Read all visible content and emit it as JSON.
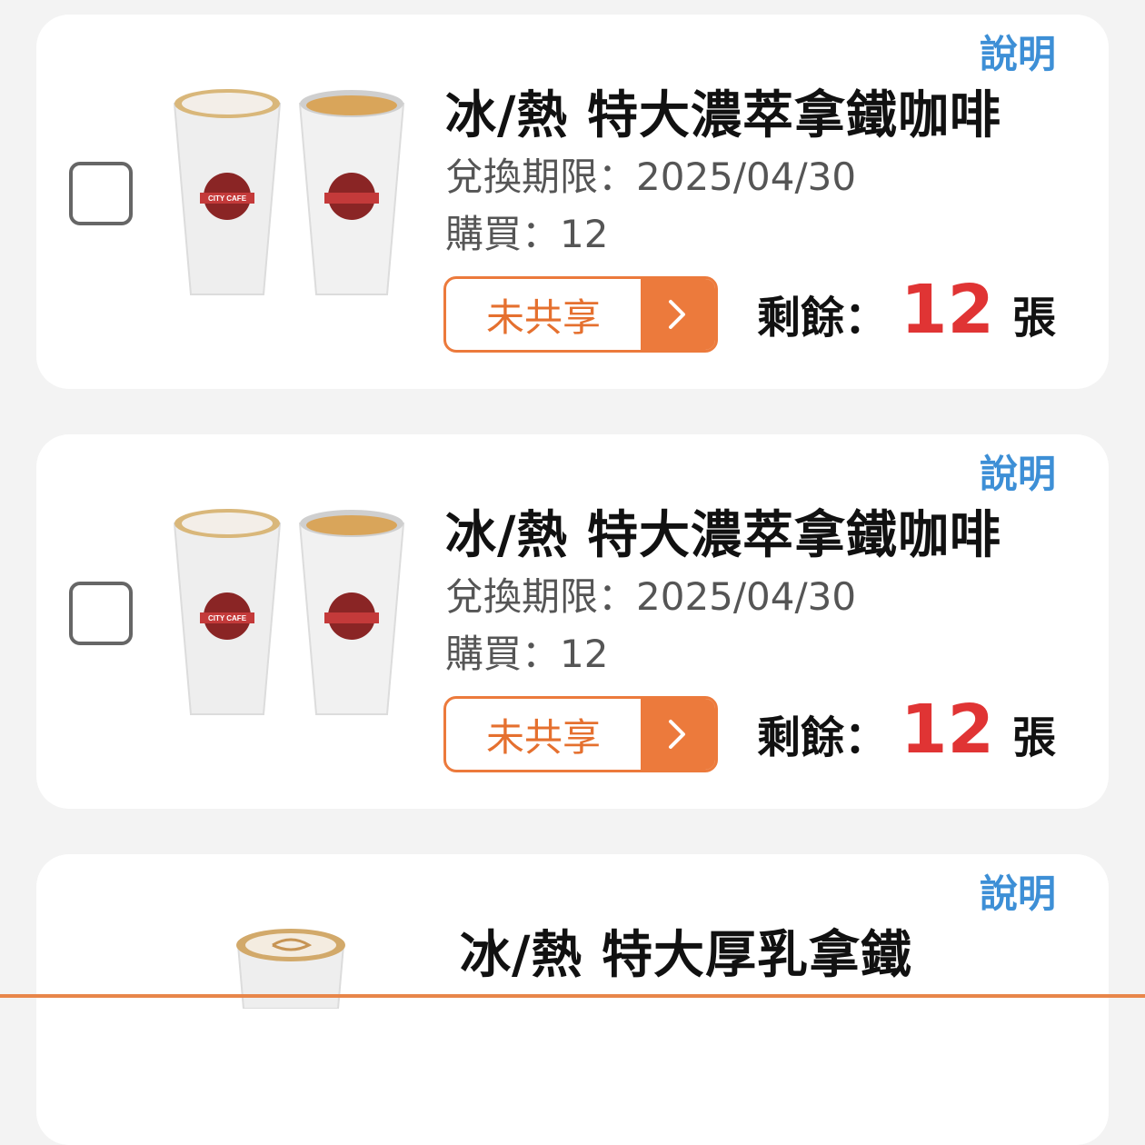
{
  "coupons": [
    {
      "info_label": "說明",
      "title": "冰/熱 特大濃萃拿鐵咖啡",
      "expiry": "兌換期限：2025/04/30",
      "purchased": "購買：12",
      "share_status": "未共享",
      "remaining_label": "剩餘：",
      "remaining_count": "12",
      "remaining_unit": "張",
      "logo_text": "CITY CAFE"
    },
    {
      "info_label": "說明",
      "title": "冰/熱 特大濃萃拿鐵咖啡",
      "expiry": "兌換期限：2025/04/30",
      "purchased": "購買：12",
      "share_status": "未共享",
      "remaining_label": "剩餘：",
      "remaining_count": "12",
      "remaining_unit": "張",
      "logo_text": "CITY CAFE"
    },
    {
      "info_label": "說明",
      "title": "冰/熱 特大厚乳拿鐵"
    }
  ],
  "colors": {
    "accent_orange": "#ec7a3c",
    "link_blue": "#3d8fd6",
    "count_red": "#e03434",
    "background": "#f3f3f3"
  }
}
